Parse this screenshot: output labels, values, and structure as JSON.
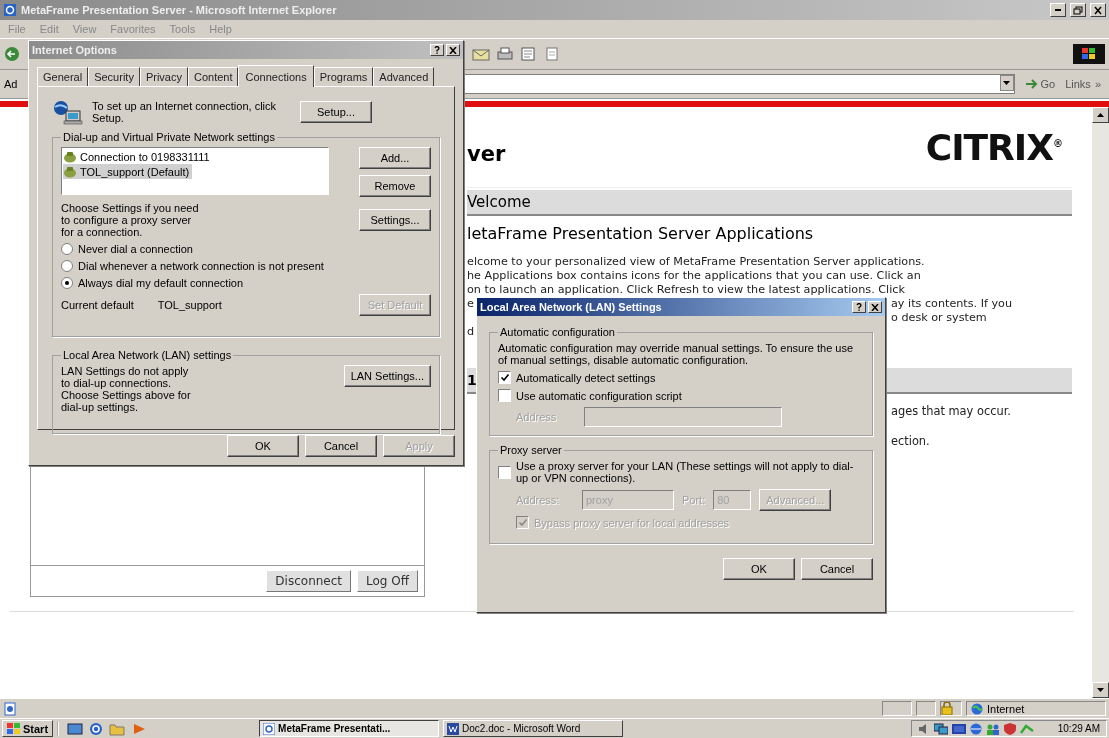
{
  "browser": {
    "title": "MetaFrame Presentation Server - Microsoft Internet Explorer",
    "menu": [
      "File",
      "Edit",
      "View",
      "Favorites",
      "Tools",
      "Help"
    ],
    "address": {
      "label": "Ad",
      "go": "Go",
      "links": "Links",
      "more": "»"
    },
    "page": {
      "heading": "ver",
      "logo": "CITRIX$^{®}$",
      "welcome": "Velcome",
      "title": "letaFrame Presentation Server Applications",
      "lines": [
        {
          "left": "elcome to your personalized view of MetaFrame Presentation Server applications."
        },
        {
          "left": "he Applications box contains icons for the applications that you can use. Click an"
        },
        {
          "left": "on to launch an application. Click Refresh to view the latest applications. Click"
        },
        {
          "left": "e",
          "right": "ay its contents. If you"
        },
        {
          "right": "o desk or system"
        },
        {
          "left": "d"
        }
      ],
      "section": "1",
      "notes": [
        {
          "right": "ages that may occur."
        },
        {
          "right": "ection."
        }
      ],
      "buttons": [
        "Disconnect",
        "Log Off"
      ]
    },
    "status_bar": {
      "zone": "Internet"
    }
  },
  "internet_options": {
    "title": "Internet Options",
    "tabs": [
      {
        "label": "General",
        "selected": false
      },
      {
        "label": "Security",
        "selected": false
      },
      {
        "label": "Privacy",
        "selected": false
      },
      {
        "label": "Content",
        "selected": false
      },
      {
        "label": "Connections",
        "selected": true
      },
      {
        "label": "Programs",
        "selected": false
      },
      {
        "label": "Advanced",
        "selected": false
      }
    ],
    "setup_text": "To set up an Internet connection, click Setup.",
    "setup_button": "Setup...",
    "dialup": {
      "legend": "Dial-up and Virtual Private Network settings",
      "connections": [
        {
          "label": "Connection to 0198331111",
          "selected": false
        },
        {
          "label": "TOL_support (Default)",
          "selected": true
        }
      ],
      "add": "Add...",
      "remove": "Remove",
      "settings_text": "Choose Settings if you need to configure a proxy server for a connection.",
      "settings": "Settings...",
      "options": [
        {
          "label": "Never dial a connection",
          "selected": false
        },
        {
          "label": "Dial whenever a network connection is not present",
          "selected": false
        },
        {
          "label": "Always dial my default connection",
          "selected": true
        }
      ],
      "current_label": "Current default",
      "current_value": "TOL_support",
      "set_default": {
        "label": "Set Default",
        "disabled": true
      }
    },
    "lan": {
      "legend": "Local Area Network (LAN) settings",
      "text": "LAN Settings do not apply to dial-up connections. Choose Settings above for dial-up settings.",
      "button": "LAN Settings..."
    },
    "buttons": [
      {
        "label": "OK",
        "disabled": false
      },
      {
        "label": "Cancel",
        "disabled": false
      },
      {
        "label": "Apply",
        "disabled": true
      }
    ]
  },
  "lan_settings": {
    "title": "Local Area Network (LAN) Settings",
    "auto": {
      "legend": "Automatic configuration",
      "text": "Automatic configuration may override manual settings. To ensure the use of manual settings, disable automatic configuration.",
      "detect": {
        "label": "Automatically detect settings",
        "checked": true
      },
      "script": {
        "label": "Use automatic configuration script",
        "checked": false
      },
      "address": {
        "label": "Address",
        "disabled": true
      }
    },
    "proxy": {
      "legend": "Proxy server",
      "use": {
        "label": "Use a proxy server for your LAN (These settings will not apply to dial-up or VPN connections).",
        "checked": false
      },
      "disabled": true,
      "address": {
        "label": "Address:",
        "value": "proxy"
      },
      "port": {
        "label": "Port:",
        "value": "80"
      },
      "advanced": "Advanced...",
      "bypass": {
        "label": "Bypass proxy server for local addresses",
        "checked": true
      }
    },
    "buttons": [
      "OK",
      "Cancel"
    ]
  },
  "taskbar": {
    "start": "Start",
    "tasks": [
      {
        "label": "MetaFrame Presentati...",
        "selected": true
      },
      {
        "label": "Doc2.doc - Microsoft Word",
        "selected": false
      }
    ],
    "clock": "10:29 AM"
  }
}
